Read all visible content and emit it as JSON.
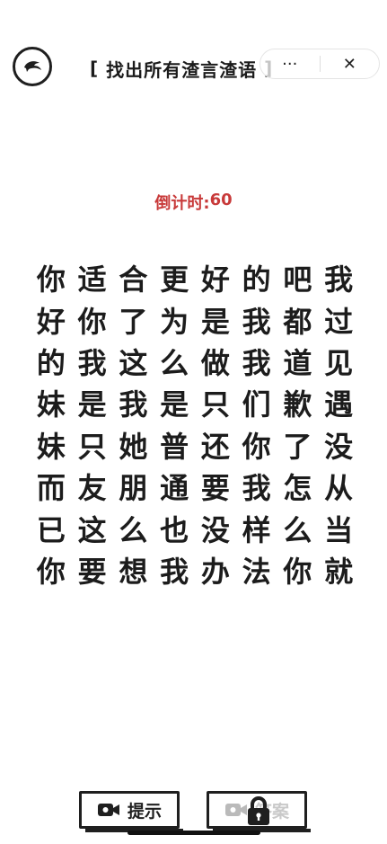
{
  "header": {
    "bracket_left": "[",
    "title": "找出所有渣言渣语",
    "bracket_right": "]",
    "capsule_more": "···",
    "capsule_close": "✕"
  },
  "timer": {
    "label": "倒计时:",
    "value": "60"
  },
  "grid": [
    [
      "你",
      "适",
      "合",
      "更",
      "好",
      "的",
      "吧",
      "我"
    ],
    [
      "好",
      "你",
      "了",
      "为",
      "是",
      "我",
      "都",
      "过"
    ],
    [
      "的",
      "我",
      "这",
      "么",
      "做",
      "我",
      "道",
      "见"
    ],
    [
      "妹",
      "是",
      "我",
      "是",
      "只",
      "们",
      "歉",
      "遇"
    ],
    [
      "妹",
      "只",
      "她",
      "普",
      "还",
      "你",
      "了",
      "没"
    ],
    [
      "而",
      "友",
      "朋",
      "通",
      "要",
      "我",
      "怎",
      "从"
    ],
    [
      "已",
      "这",
      "么",
      "也",
      "没",
      "样",
      "么",
      "当"
    ],
    [
      "你",
      "要",
      "想",
      "我",
      "办",
      "法",
      "你",
      "就"
    ]
  ],
  "buttons": {
    "hint": "提示",
    "answer": "答案"
  },
  "icons": {
    "back": "dolphin-back-icon",
    "video": "video-camera-icon",
    "lock": "lock-icon"
  },
  "colors": {
    "timer": "#c83a3a",
    "text": "#1c1c1c"
  }
}
